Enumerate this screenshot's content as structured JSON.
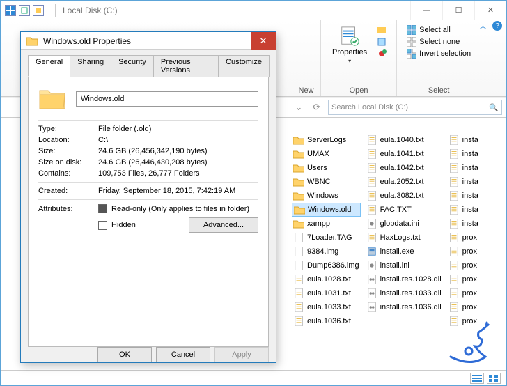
{
  "explorer": {
    "title": "Local Disk (C:)",
    "search_placeholder": "Search Local Disk (C:)",
    "ribbon": {
      "groups": {
        "new": {
          "label": "New"
        },
        "open": {
          "label": "Open",
          "big": "Properties",
          "items": [
            "",
            "",
            ""
          ]
        },
        "select": {
          "label": "Select",
          "items": [
            "Select all",
            "Select none",
            "Invert selection"
          ]
        }
      }
    },
    "columns": [
      [
        {
          "icon": "folder",
          "name": "ServerLogs"
        },
        {
          "icon": "folder",
          "name": "UMAX"
        },
        {
          "icon": "folder",
          "name": "Users"
        },
        {
          "icon": "folder",
          "name": "WBNC"
        },
        {
          "icon": "folder",
          "name": "Windows"
        },
        {
          "icon": "folder",
          "name": "Windows.old",
          "selected": true
        },
        {
          "icon": "folder",
          "name": "xampp"
        },
        {
          "icon": "file",
          "name": "7Loader.TAG"
        },
        {
          "icon": "file",
          "name": "9384.img"
        },
        {
          "icon": "file",
          "name": "Dump6386.img"
        },
        {
          "icon": "txt",
          "name": "eula.1028.txt"
        },
        {
          "icon": "txt",
          "name": "eula.1031.txt"
        },
        {
          "icon": "txt",
          "name": "eula.1033.txt"
        },
        {
          "icon": "txt",
          "name": "eula.1036.txt"
        }
      ],
      [
        {
          "icon": "txt",
          "name": "eula.1040.txt"
        },
        {
          "icon": "txt",
          "name": "eula.1041.txt"
        },
        {
          "icon": "txt",
          "name": "eula.1042.txt"
        },
        {
          "icon": "txt",
          "name": "eula.2052.txt"
        },
        {
          "icon": "txt",
          "name": "eula.3082.txt"
        },
        {
          "icon": "txt",
          "name": "FAC.TXT"
        },
        {
          "icon": "ini",
          "name": "globdata.ini"
        },
        {
          "icon": "txt",
          "name": "HaxLogs.txt"
        },
        {
          "icon": "exe",
          "name": "install.exe"
        },
        {
          "icon": "ini",
          "name": "install.ini"
        },
        {
          "icon": "dll",
          "name": "install.res.1028.dll"
        },
        {
          "icon": "dll",
          "name": "install.res.1033.dll"
        },
        {
          "icon": "dll",
          "name": "install.res.1036.dll"
        }
      ],
      [
        {
          "icon": "txt",
          "name": "insta"
        },
        {
          "icon": "txt",
          "name": "insta"
        },
        {
          "icon": "txt",
          "name": "insta"
        },
        {
          "icon": "txt",
          "name": "insta"
        },
        {
          "icon": "txt",
          "name": "insta"
        },
        {
          "icon": "txt",
          "name": "insta"
        },
        {
          "icon": "txt",
          "name": "insta"
        },
        {
          "icon": "txt",
          "name": "prox"
        },
        {
          "icon": "txt",
          "name": "prox"
        },
        {
          "icon": "txt",
          "name": "prox"
        },
        {
          "icon": "txt",
          "name": "prox"
        },
        {
          "icon": "txt",
          "name": "prox"
        },
        {
          "icon": "txt",
          "name": "prox"
        },
        {
          "icon": "txt",
          "name": "prox"
        }
      ]
    ]
  },
  "dialog": {
    "title": "Windows.old Properties",
    "tabs": [
      "General",
      "Sharing",
      "Security",
      "Previous Versions",
      "Customize"
    ],
    "name_value": "Windows.old",
    "props": {
      "type_k": "Type:",
      "type_v": "File folder (.old)",
      "loc_k": "Location:",
      "loc_v": "C:\\",
      "size_k": "Size:",
      "size_v": "24.6 GB (26,456,342,190 bytes)",
      "sod_k": "Size on disk:",
      "sod_v": "24.6 GB (26,446,430,208 bytes)",
      "cont_k": "Contains:",
      "cont_v": "109,753 Files, 26,777 Folders",
      "created_k": "Created:",
      "created_v": "Friday, September 18, 2015, 7:42:19 AM",
      "attr_k": "Attributes:",
      "readonly_label": "Read-only (Only applies to files in folder)",
      "hidden_label": "Hidden",
      "advanced_label": "Advanced..."
    },
    "buttons": {
      "ok": "OK",
      "cancel": "Cancel",
      "apply": "Apply"
    }
  }
}
